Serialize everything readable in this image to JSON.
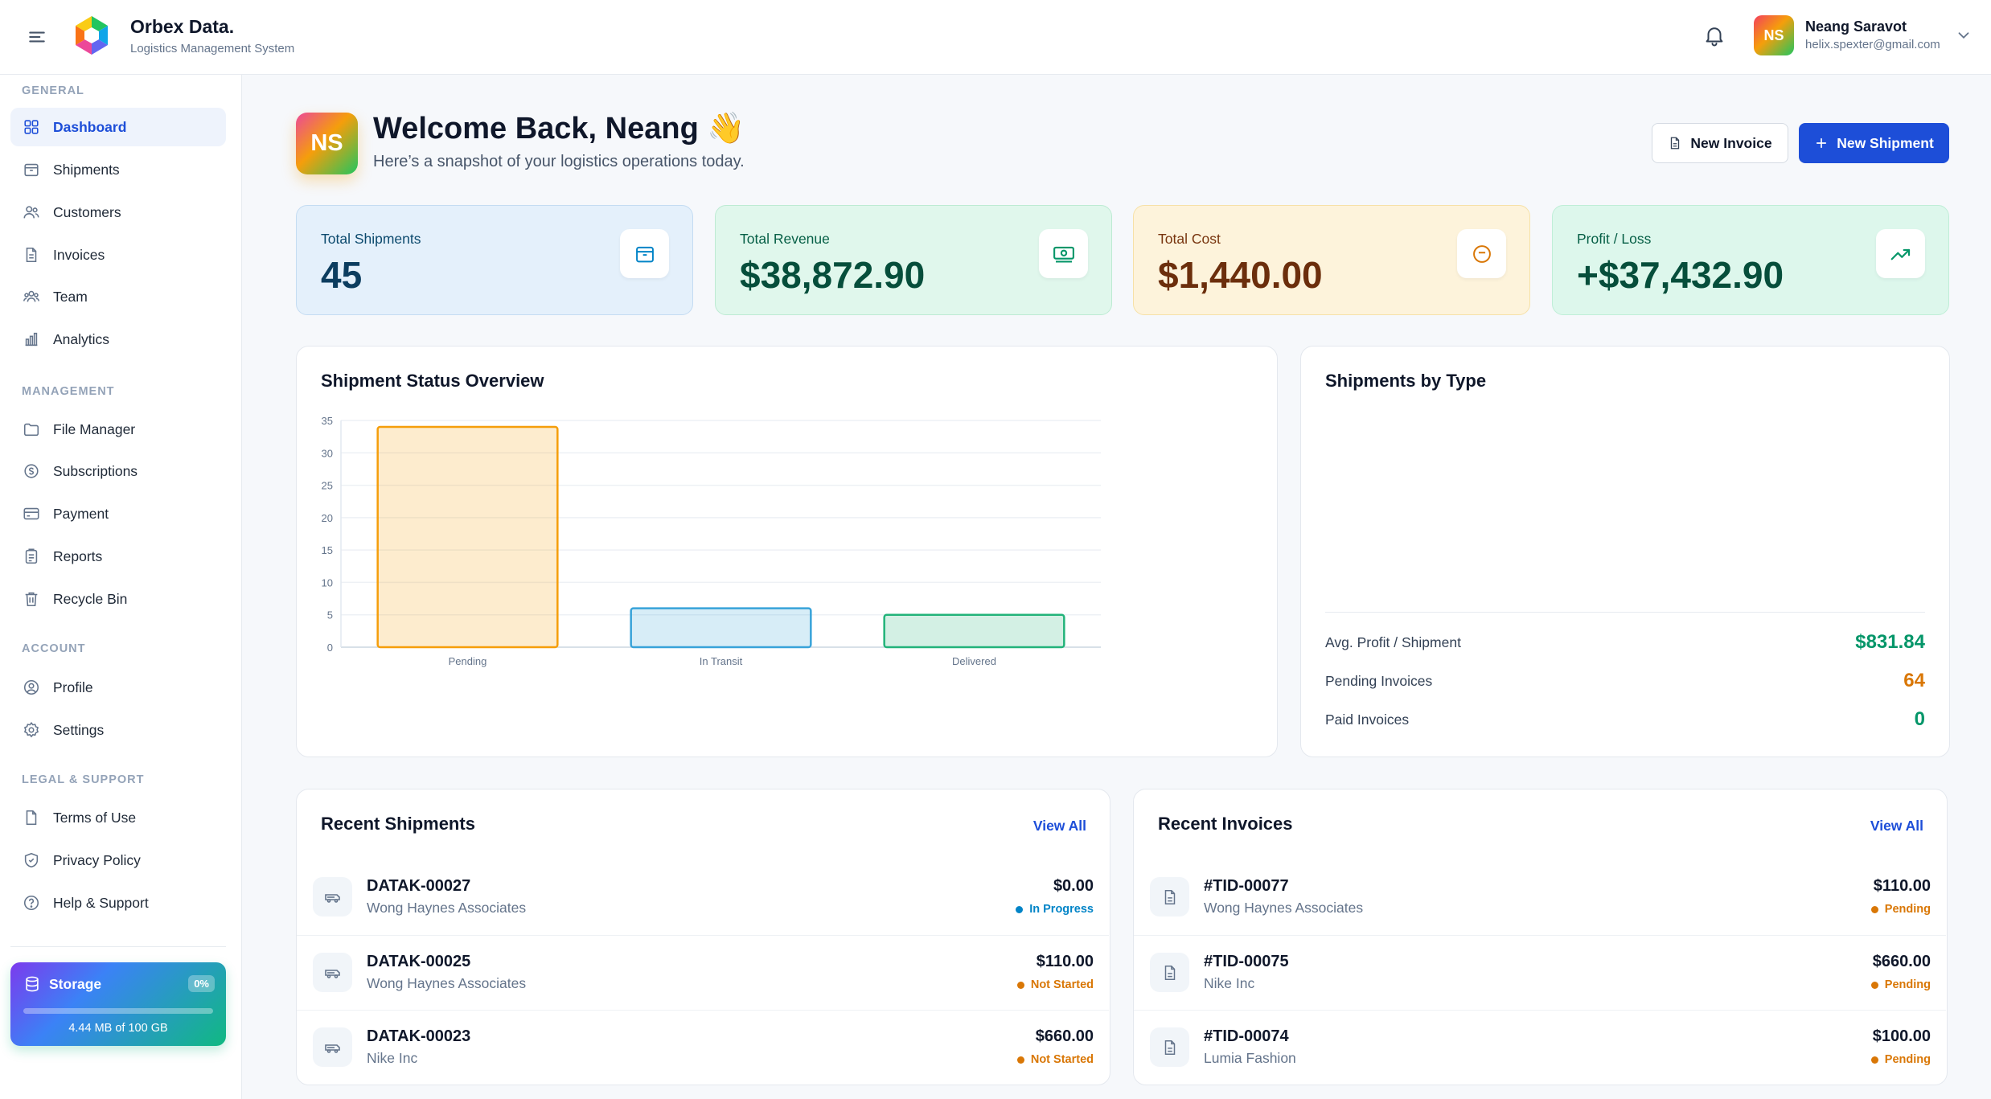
{
  "header": {
    "brand_name": "Orbex Data.",
    "brand_subtitle": "Logistics Management System",
    "user": {
      "initials": "NS",
      "name": "Neang Saravot",
      "email": "helix.spexter@gmail.com"
    }
  },
  "sidebar": {
    "sections": [
      {
        "label": "GENERAL",
        "items": [
          {
            "label": "Dashboard",
            "icon": "grid-icon",
            "active": true
          },
          {
            "label": "Shipments",
            "icon": "box-icon"
          },
          {
            "label": "Customers",
            "icon": "users-icon"
          },
          {
            "label": "Invoices",
            "icon": "document-icon"
          },
          {
            "label": "Team",
            "icon": "team-icon"
          },
          {
            "label": "Analytics",
            "icon": "bar-chart-icon"
          }
        ]
      },
      {
        "label": "MANAGEMENT",
        "items": [
          {
            "label": "File Manager",
            "icon": "folder-icon"
          },
          {
            "label": "Subscriptions",
            "icon": "subscription-icon"
          },
          {
            "label": "Payment",
            "icon": "credit-card-icon"
          },
          {
            "label": "Reports",
            "icon": "report-icon"
          },
          {
            "label": "Recycle Bin",
            "icon": "trash-icon"
          }
        ]
      },
      {
        "label": "ACCOUNT",
        "items": [
          {
            "label": "Profile",
            "icon": "profile-icon"
          },
          {
            "label": "Settings",
            "icon": "gear-icon"
          }
        ]
      },
      {
        "label": "LEGAL & SUPPORT",
        "items": [
          {
            "label": "Terms of Use",
            "icon": "file-icon"
          },
          {
            "label": "Privacy Policy",
            "icon": "shield-icon"
          },
          {
            "label": "Help & Support",
            "icon": "help-icon"
          }
        ]
      }
    ],
    "storage": {
      "title": "Storage",
      "percent_label": "0%",
      "percent": 0,
      "usage": "4.44 MB of 100 GB"
    }
  },
  "welcome": {
    "initials": "NS",
    "title": "Welcome Back, Neang",
    "emoji": "👋",
    "subtitle": "Here’s a snapshot of your logistics operations today.",
    "new_invoice_label": "New Invoice",
    "new_shipment_label": "New Shipment"
  },
  "stats": [
    {
      "label": "Total Shipments",
      "value": "45",
      "icon": "package-icon"
    },
    {
      "label": "Total Revenue",
      "value": "$38,872.90",
      "icon": "banknote-icon"
    },
    {
      "label": "Total Cost",
      "value": "$1,440.00",
      "icon": "coin-icon"
    },
    {
      "label": "Profit / Loss",
      "value": "+$37,432.90",
      "icon": "trend-up-icon"
    }
  ],
  "status_overview": {
    "title": "Shipment Status Overview",
    "chart_data": {
      "type": "bar",
      "categories": [
        "Pending",
        "In Transit",
        "Delivered"
      ],
      "values": [
        34,
        6,
        5
      ],
      "ylim": [
        0,
        35
      ],
      "yticks": [
        0,
        5,
        10,
        15,
        20,
        25,
        30,
        35
      ],
      "grid": true,
      "colors": {
        "Pending": "#f59e0b",
        "In Transit": "#38a3d9",
        "Delivered": "#22b37a"
      }
    }
  },
  "shipments_by_type": {
    "title": "Shipments by Type",
    "metrics": [
      {
        "label": "Avg. Profit / Shipment",
        "value": "$831.84",
        "color": "#059669"
      },
      {
        "label": "Pending Invoices",
        "value": "64",
        "color": "#d97706"
      },
      {
        "label": "Paid Invoices",
        "value": "0",
        "color": "#059669"
      }
    ]
  },
  "recent_shipments": {
    "title": "Recent Shipments",
    "view_all": "View All",
    "rows": [
      {
        "id": "DATAK-00027",
        "customer": "Wong Haynes Associates",
        "amount": "$0.00",
        "status": "In Progress",
        "status_color": "#0284c7"
      },
      {
        "id": "DATAK-00025",
        "customer": "Wong Haynes Associates",
        "amount": "$110.00",
        "status": "Not Started",
        "status_color": "#d97706"
      },
      {
        "id": "DATAK-00023",
        "customer": "Nike Inc",
        "amount": "$660.00",
        "status": "Not Started",
        "status_color": "#d97706"
      }
    ]
  },
  "recent_invoices": {
    "title": "Recent Invoices",
    "view_all": "View All",
    "rows": [
      {
        "id": "#TID-00077",
        "customer": "Wong Haynes Associates",
        "amount": "$110.00",
        "status": "Pending",
        "status_color": "#d97706"
      },
      {
        "id": "#TID-00075",
        "customer": "Nike Inc",
        "amount": "$660.00",
        "status": "Pending",
        "status_color": "#d97706"
      },
      {
        "id": "#TID-00074",
        "customer": "Lumia Fashion",
        "amount": "$100.00",
        "status": "Pending",
        "status_color": "#d97706"
      }
    ]
  }
}
